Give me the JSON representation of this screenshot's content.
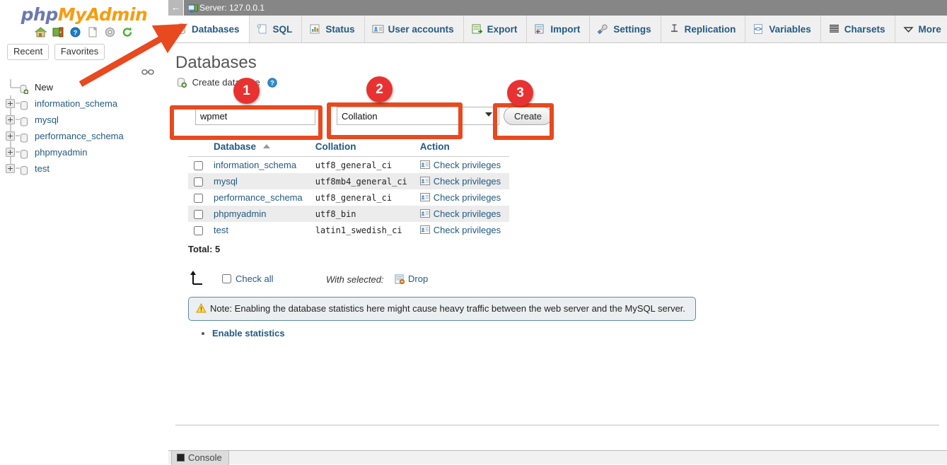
{
  "sidebar": {
    "logo": {
      "part1": "php",
      "part2": "My",
      "part3": "Admin"
    },
    "logo_icons": [
      "home-icon",
      "server-exit-icon",
      "help-icon",
      "docs-icon",
      "settings-icon",
      "refresh-icon"
    ],
    "quick_tabs": [
      {
        "label": "Recent",
        "name": "recent-tab"
      },
      {
        "label": "Favorites",
        "name": "favorites-tab"
      }
    ],
    "tree": [
      {
        "label": "New",
        "expandable": false
      },
      {
        "label": "information_schema",
        "expandable": true
      },
      {
        "label": "mysql",
        "expandable": true
      },
      {
        "label": "performance_schema",
        "expandable": true
      },
      {
        "label": "phpmyadmin",
        "expandable": true
      },
      {
        "label": "test",
        "expandable": true
      }
    ]
  },
  "server_bar": {
    "back_glyph": "←",
    "text": "Server: 127.0.0.1"
  },
  "tabs": [
    {
      "label": "Databases",
      "icon": "database-icon",
      "active": true
    },
    {
      "label": "SQL",
      "icon": "sql-scroll-icon",
      "active": false
    },
    {
      "label": "Status",
      "icon": "status-chart-icon",
      "active": false
    },
    {
      "label": "User accounts",
      "icon": "user-card-icon",
      "active": false
    },
    {
      "label": "Export",
      "icon": "export-icon",
      "active": false
    },
    {
      "label": "Import",
      "icon": "import-icon",
      "active": false
    },
    {
      "label": "Settings",
      "icon": "wrench-icon",
      "active": false
    },
    {
      "label": "Replication",
      "icon": "replication-icon",
      "active": false
    },
    {
      "label": "Variables",
      "icon": "variables-icon",
      "active": false
    },
    {
      "label": "Charsets",
      "icon": "charsets-icon",
      "active": false
    },
    {
      "label": "More",
      "icon": "chevron-down-icon",
      "active": false
    }
  ],
  "page": {
    "title": "Databases",
    "create_label": "Create database",
    "create_icon": "database-add-icon",
    "help_icon": "help-icon"
  },
  "form": {
    "db_name_value": "wpmet",
    "db_name_placeholder": "Database name",
    "collation_selected": "Collation",
    "collation_options": [
      "Collation"
    ],
    "create_button": "Create"
  },
  "table": {
    "columns": [
      "Database",
      "Collation",
      "Action"
    ],
    "sort_indicator": "ascending",
    "rows": [
      {
        "checked": false,
        "database": "information_schema",
        "collation": "utf8_general_ci",
        "action": "Check privileges"
      },
      {
        "checked": false,
        "database": "mysql",
        "collation": "utf8mb4_general_ci",
        "action": "Check privileges"
      },
      {
        "checked": false,
        "database": "performance_schema",
        "collation": "utf8_general_ci",
        "action": "Check privileges"
      },
      {
        "checked": false,
        "database": "phpmyadmin",
        "collation": "utf8_bin",
        "action": "Check privileges"
      },
      {
        "checked": false,
        "database": "test",
        "collation": "latin1_swedish_ci",
        "action": "Check privileges"
      }
    ],
    "total": "Total: 5"
  },
  "actions": {
    "check_all": "Check all",
    "with_selected": "With selected:",
    "drop": "Drop",
    "drop_icon": "drop-table-icon"
  },
  "note": {
    "icon": "warning-icon",
    "text": "Note: Enabling the database statistics here might cause heavy traffic between the web server and the MySQL server."
  },
  "enable_statistics": "Enable statistics",
  "console": {
    "label": "Console",
    "icon": "console-icon"
  },
  "annotations": {
    "arrow": {
      "name": "red-pointer-arrow",
      "color": "#e8491e"
    },
    "badges": [
      {
        "number": "1",
        "target": "database-name-input"
      },
      {
        "number": "2",
        "target": "collation-select"
      },
      {
        "number": "3",
        "target": "create-button"
      }
    ],
    "highlight_color": "#e8491e"
  }
}
